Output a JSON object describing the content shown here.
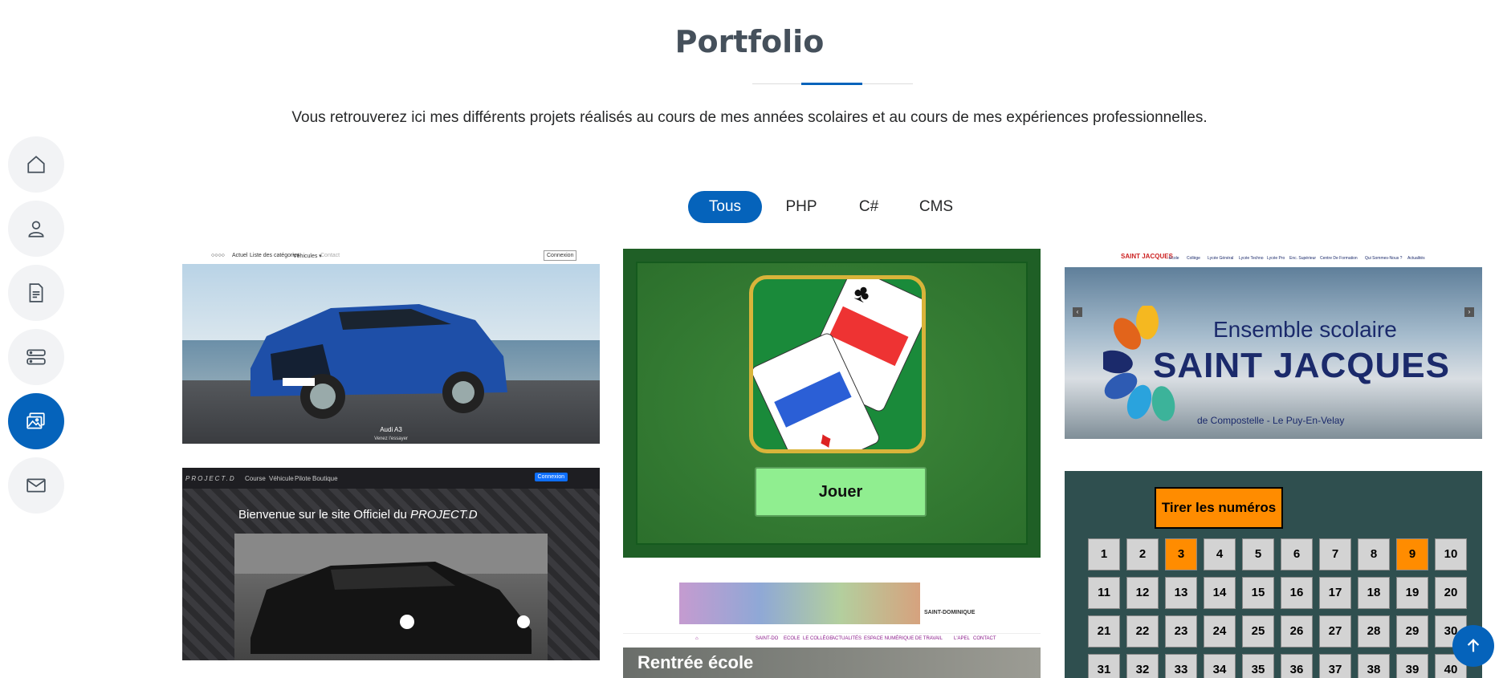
{
  "section": {
    "title": "Portfolio",
    "subtitle": "Vous retrouverez ici mes différents projets réalisés au cours de mes années scolaires et au cours de mes expériences professionnelles."
  },
  "sidenav": {
    "items": [
      {
        "name": "home",
        "icon": "home-icon",
        "active": false
      },
      {
        "name": "about",
        "icon": "person-icon",
        "active": false
      },
      {
        "name": "resume",
        "icon": "document-icon",
        "active": false
      },
      {
        "name": "services",
        "icon": "server-icon",
        "active": false
      },
      {
        "name": "portfolio",
        "icon": "images-icon",
        "active": true
      },
      {
        "name": "contact",
        "icon": "envelope-icon",
        "active": false
      }
    ]
  },
  "filters": [
    {
      "label": "Tous",
      "active": true
    },
    {
      "label": "PHP",
      "active": false
    },
    {
      "label": "C#",
      "active": false
    },
    {
      "label": "CMS",
      "active": false
    }
  ],
  "projects": {
    "audi": {
      "nav": [
        "Actuel",
        "Liste des catégories",
        "Véhicules ▾",
        "Contact"
      ],
      "login": "Connexion",
      "caption": "Audi A3",
      "subcaption": "Venez l'essayer"
    },
    "projectd": {
      "logo": "PROJECT.D",
      "nav": [
        "Course",
        "Véhicule",
        "Pilote",
        "Boutique"
      ],
      "login": "Connexion",
      "welcome_prefix": "Bienvenue sur le site Officiel du ",
      "welcome_brand": "PROJECT.D"
    },
    "solitaire": {
      "play_label": "Jouer"
    },
    "saintdominique": {
      "logo_text": "SAINT-DOMINIQUE",
      "menu": [
        "SAINT-DO",
        "ECOLE",
        "LE COLLÈGE",
        "ACTUALITÉS",
        "ESPACE NUMÉRIQUE DE TRAVAIL",
        "L'APEL",
        "CONTACT"
      ],
      "banner": "Rentrée école"
    },
    "saintjacques": {
      "nav": [
        "Ecole",
        "Collège",
        "Lycée Général",
        "Lycée Techno",
        "Lycée Pro",
        "Enc. Supérieur",
        "Centre De Formation",
        "Qui Sommes-Nous ?",
        "Actualités"
      ],
      "line1": "Ensemble scolaire",
      "line2": "SAINT JACQUES",
      "line3": "de Compostelle - Le Puy-En-Velay"
    },
    "lotto": {
      "draw_label": "Tirer les numéros",
      "numbers": [
        1,
        2,
        3,
        4,
        5,
        6,
        7,
        8,
        9,
        10,
        11,
        12,
        13,
        14,
        15,
        16,
        17,
        18,
        19,
        20,
        21,
        22,
        23,
        24,
        25,
        26,
        27,
        28,
        29,
        30,
        31,
        32,
        33,
        34,
        35,
        36,
        37,
        38,
        39,
        40
      ],
      "drawn": [
        3,
        9
      ]
    }
  },
  "colors": {
    "accent": "#0563bb",
    "lotto_bg": "#2f4f4f",
    "lotto_hit": "#ff8c00",
    "solitaire_button": "#90ee90"
  }
}
